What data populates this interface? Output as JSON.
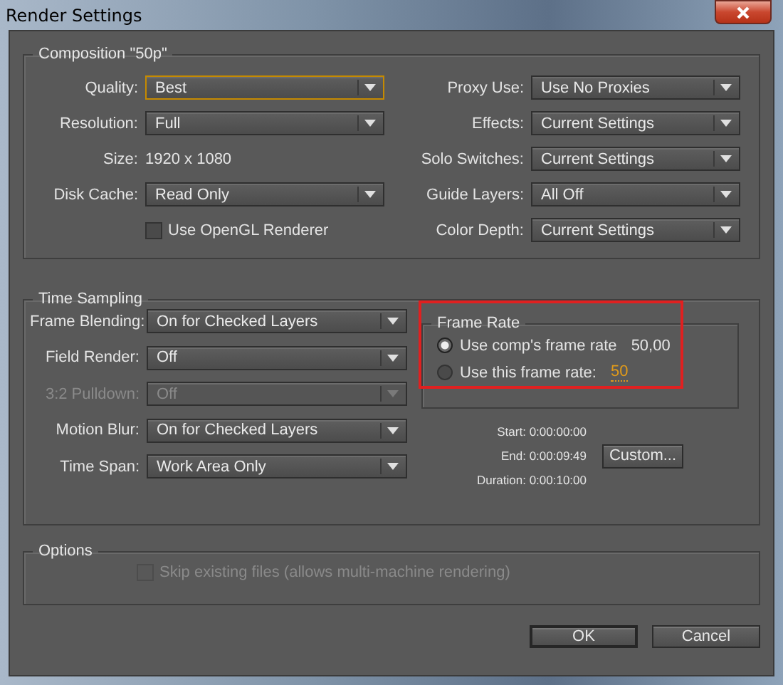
{
  "window": {
    "title": "Render Settings"
  },
  "composition": {
    "title": "Composition \"50p\"",
    "left": [
      {
        "kind": "dropdown",
        "label": "Quality:",
        "value": "Best",
        "focused": true
      },
      {
        "kind": "dropdown",
        "label": "Resolution:",
        "value": "Full",
        "focused": false
      },
      {
        "kind": "text",
        "label": "Size:",
        "value": "1920 x 1080"
      },
      {
        "kind": "dropdown",
        "label": "Disk Cache:",
        "value": "Read Only",
        "focused": false
      },
      {
        "kind": "checkbox",
        "label": "Use OpenGL Renderer",
        "checked": false
      }
    ],
    "right": [
      {
        "kind": "dropdown",
        "label": "Proxy Use:",
        "value": "Use No Proxies",
        "focused": false
      },
      {
        "kind": "dropdown",
        "label": "Effects:",
        "value": "Current Settings",
        "focused": false
      },
      {
        "kind": "dropdown",
        "label": "Solo Switches:",
        "value": "Current Settings",
        "focused": false
      },
      {
        "kind": "dropdown",
        "label": "Guide Layers:",
        "value": "All Off",
        "focused": false
      },
      {
        "kind": "dropdown",
        "label": "Color Depth:",
        "value": "Current Settings",
        "focused": false
      }
    ]
  },
  "time_sampling": {
    "title": "Time Sampling",
    "fields": [
      {
        "label": "Frame Blending:",
        "value": "On for Checked Layers",
        "disabled": false
      },
      {
        "label": "Field Render:",
        "value": "Off",
        "disabled": false
      },
      {
        "label": "3:2 Pulldown:",
        "value": "Off",
        "disabled": true
      },
      {
        "label": "Motion Blur:",
        "value": "On for Checked Layers",
        "disabled": false
      },
      {
        "label": "Time Span:",
        "value": "Work Area Only",
        "disabled": false
      }
    ],
    "frame_rate": {
      "title": "Frame Rate",
      "highlighted": true,
      "options": [
        {
          "label": "Use comp's frame rate",
          "value": "50,00",
          "selected": true
        },
        {
          "label": "Use this frame rate:",
          "value": "50",
          "selected": false
        }
      ]
    },
    "times": [
      {
        "label": "Start:",
        "value": "0:00:00:00"
      },
      {
        "label": "End:",
        "value": "0:00:09:49"
      },
      {
        "label": "Duration:",
        "value": "0:00:10:00"
      }
    ],
    "custom_button": "Custom..."
  },
  "options": {
    "title": "Options",
    "checkboxes": [
      {
        "label": "Skip existing files (allows multi-machine rendering)",
        "checked": false,
        "disabled": true
      }
    ]
  },
  "buttons": [
    {
      "label": "OK",
      "default": true
    },
    {
      "label": "Cancel",
      "default": false
    }
  ]
}
